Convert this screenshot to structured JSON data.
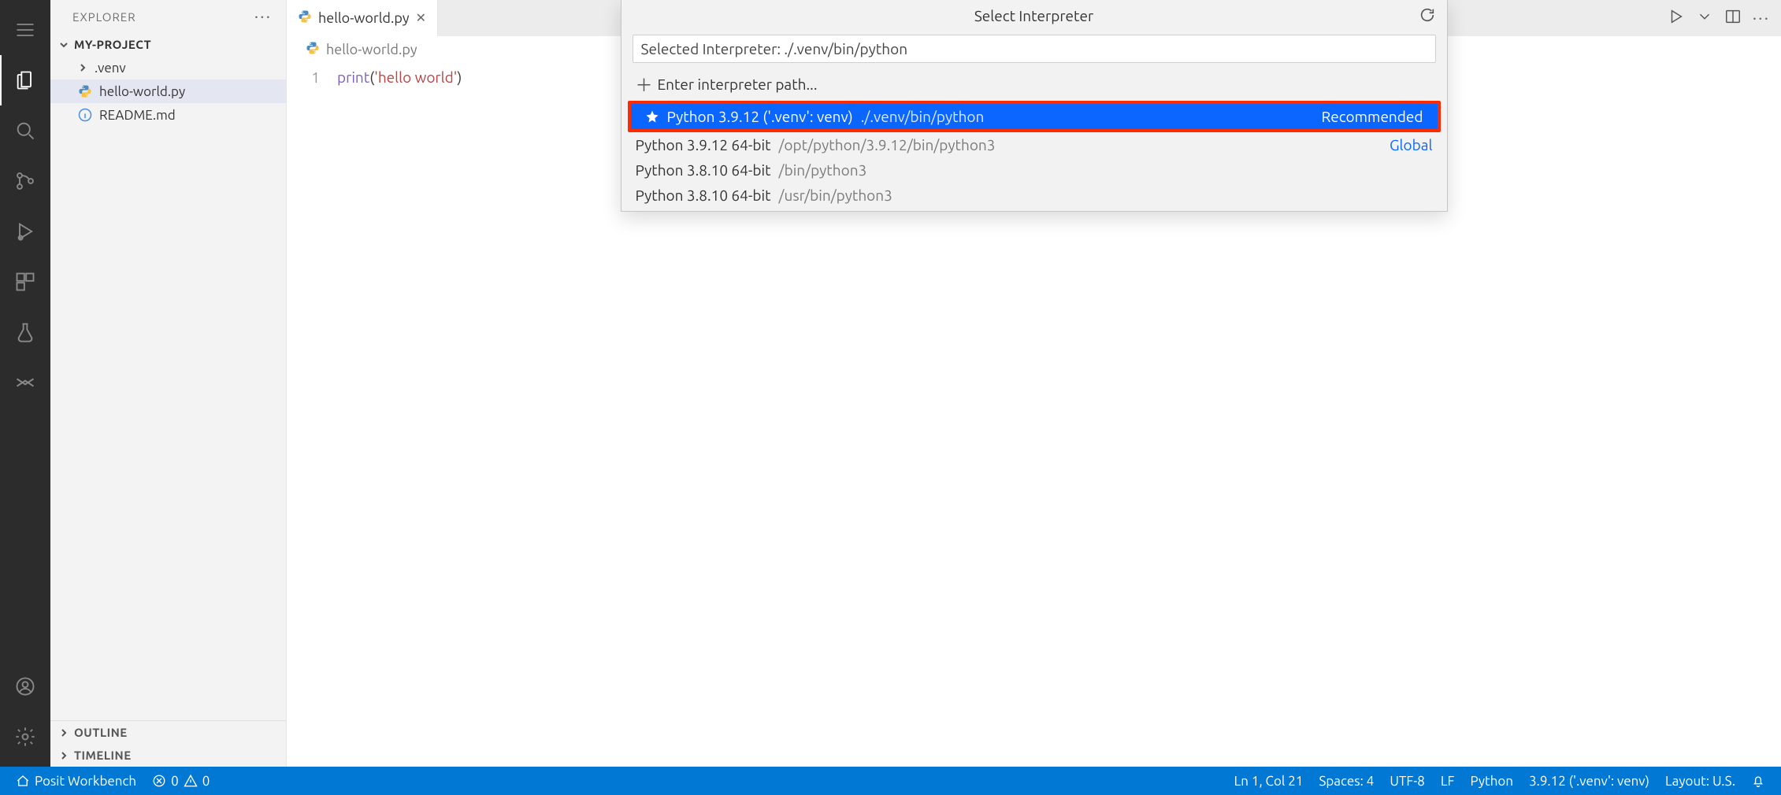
{
  "sidebar": {
    "title": "EXPLORER",
    "project": "MY-PROJECT",
    "tree": {
      "venv": ".venv",
      "hello": "hello-world.py",
      "readme": "README.md"
    },
    "outline": "OUTLINE",
    "timeline": "TIMELINE"
  },
  "tab": {
    "label": "hello-world.py"
  },
  "breadcrumb": {
    "file": "hello-world.py"
  },
  "code": {
    "lineno": "1",
    "fn": "print",
    "open": "(",
    "str": "'hello world'",
    "close": ")"
  },
  "quickpick": {
    "title": "Select Interpreter",
    "input": "Selected Interpreter: ./.venv/bin/python",
    "enter_path": "Enter interpreter path...",
    "items": [
      {
        "label": "Python 3.9.12 ('.venv': venv)",
        "path": "./.venv/bin/python",
        "badge": "Recommended",
        "kind": "recommended"
      },
      {
        "label": "Python 3.9.12 64-bit",
        "path": "/opt/python/3.9.12/bin/python3",
        "badge": "Global",
        "kind": "global"
      },
      {
        "label": "Python 3.8.10 64-bit",
        "path": "/bin/python3",
        "badge": "",
        "kind": ""
      },
      {
        "label": "Python 3.8.10 64-bit",
        "path": "/usr/bin/python3",
        "badge": "",
        "kind": ""
      }
    ]
  },
  "status": {
    "remote": "Posit Workbench",
    "errors": "0",
    "warnings": "0",
    "cursor": "Ln 1, Col 21",
    "spaces": "Spaces: 4",
    "encoding": "UTF-8",
    "eol": "LF",
    "lang": "Python",
    "interp": "3.9.12 ('.venv': venv)",
    "layout": "Layout: U.S."
  }
}
